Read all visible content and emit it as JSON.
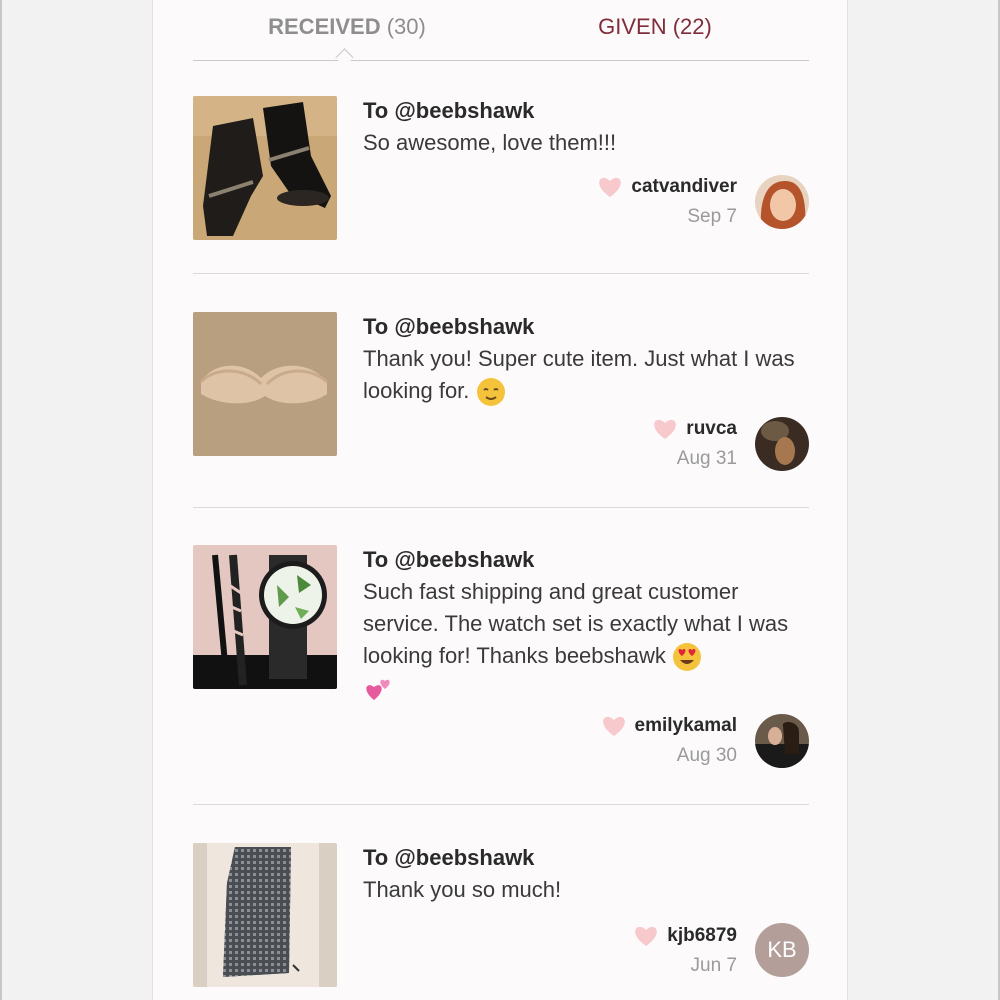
{
  "tabs": {
    "received_label": "RECEIVED",
    "received_count": "(30)",
    "given_label": "GIVEN",
    "given_count": "(22)"
  },
  "entries": [
    {
      "to": "To @beebshawk",
      "comment": "So awesome, love them!!!",
      "emoji": "",
      "username": "catvandiver",
      "date": "Sep 7",
      "thumb_icon": "boots-photo",
      "avatar_icon": "user-photo"
    },
    {
      "to": "To @beebshawk",
      "comment": "Thank you! Super cute item. Just what I was looking for. ",
      "emoji": "relieved-face-emoji",
      "username": "ruvca",
      "date": "Aug 31",
      "thumb_icon": "bra-photo",
      "avatar_icon": "user-photo"
    },
    {
      "to": "To @beebshawk",
      "comment": "Such fast shipping and great customer service. The watch set is exactly what I was looking for! Thanks beebshawk ",
      "emoji": "heart-eyes-emoji, two-hearts-emoji",
      "username": "emilykamal",
      "date": "Aug 30",
      "thumb_icon": "watch-photo",
      "avatar_icon": "user-photo"
    },
    {
      "to": "To @beebshawk",
      "comment": "Thank you so much!",
      "emoji": "",
      "username": "kjb6879",
      "date": "Jun 7",
      "thumb_icon": "cardigan-photo",
      "avatar_initials": "KB"
    }
  ],
  "colors": {
    "given_tab": "#7f2c3b",
    "received_tab": "#8e8e8e",
    "heart": "#f7c8cc",
    "initials_avatar": "#b39e9a"
  }
}
